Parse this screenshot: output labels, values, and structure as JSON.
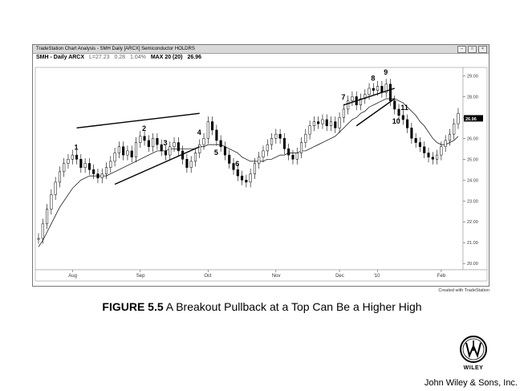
{
  "window": {
    "title": "TradeStation Chart Analysis - SMH Daily [ARCX] Semiconductor HOLDRS",
    "symbol": "SMH - Daily ARCX",
    "last": "L=27.23",
    "change": "0.28",
    "change_pct": "1.04%",
    "ma_label": "MAX 20 (20)",
    "ma_value": "26.96",
    "price_tag": "26.96",
    "credit": "Created with TradeStation"
  },
  "caption": {
    "figure": "FIGURE 5.5",
    "text": "A Breakout Pullback at a Top Can Be a Higher High"
  },
  "publisher": {
    "logo_word": "WILEY",
    "name": "John Wiley & Sons, Inc."
  },
  "colors": {
    "price": "#000000",
    "ma": "#000000",
    "tag_bg": "#000000"
  },
  "chart_data": {
    "type": "line",
    "title": "",
    "xlabel": "",
    "ylabel": "",
    "ylim": [
      19.7,
      29.4
    ],
    "yticks": [
      "29.00",
      "28.00",
      "27.00",
      "26.00",
      "25.00",
      "24.00",
      "23.00",
      "22.00",
      "21.00",
      "20.00"
    ],
    "x_tick_labels": [
      "Aug",
      "Sep",
      "Oct",
      "Nov",
      "Dec",
      "'10",
      "Feb"
    ],
    "x_ticks_at_bar": [
      8,
      24,
      40,
      56,
      71,
      80,
      95
    ],
    "grid": false,
    "series": [
      {
        "kind": "price",
        "values": [
          21.2,
          21.9,
          22.6,
          23.3,
          23.9,
          24.4,
          24.8,
          25.0,
          25.2,
          25.0,
          24.6,
          24.8,
          24.5,
          24.3,
          24.1,
          24.3,
          24.6,
          24.9,
          25.3,
          25.6,
          25.2,
          25.4,
          25.1,
          25.8,
          26.1,
          25.9,
          25.6,
          26.0,
          25.7,
          25.4,
          25.2,
          25.6,
          25.8,
          25.4,
          25.0,
          24.6,
          24.9,
          25.3,
          25.7,
          26.0,
          26.8,
          26.4,
          25.9,
          25.6,
          25.2,
          24.8,
          24.5,
          24.2,
          24.0,
          23.9,
          24.3,
          24.8,
          25.1,
          25.4,
          25.7,
          26.0,
          26.2,
          26.0,
          25.5,
          25.2,
          25.0,
          25.3,
          25.8,
          26.2,
          26.6,
          26.8,
          26.7,
          26.9,
          26.6,
          26.8,
          26.5,
          27.0,
          27.4,
          27.8,
          28.0,
          27.6,
          27.9,
          28.1,
          28.4,
          28.3,
          28.5,
          28.2,
          28.6,
          27.8,
          27.4,
          27.1,
          26.9,
          26.5,
          26.0,
          25.8,
          25.6,
          25.3,
          25.1,
          25.0,
          25.2,
          25.6,
          25.9,
          26.2,
          26.7,
          27.2
        ]
      },
      {
        "kind": "moving_average",
        "values": [
          20.8,
          21.1,
          21.5,
          21.9,
          22.3,
          22.7,
          23.0,
          23.3,
          23.6,
          23.8,
          24.0,
          24.1,
          24.2,
          24.2,
          24.2,
          24.2,
          24.2,
          24.3,
          24.4,
          24.5,
          24.6,
          24.7,
          24.8,
          24.9,
          25.0,
          25.1,
          25.2,
          25.3,
          25.4,
          25.4,
          25.4,
          25.5,
          25.5,
          25.5,
          25.5,
          25.5,
          25.5,
          25.5,
          25.6,
          25.6,
          25.7,
          25.7,
          25.7,
          25.7,
          25.6,
          25.5,
          25.4,
          25.3,
          25.1,
          25.0,
          24.9,
          24.9,
          24.9,
          24.9,
          25.0,
          25.0,
          25.1,
          25.2,
          25.2,
          25.3,
          25.3,
          25.3,
          25.4,
          25.4,
          25.5,
          25.6,
          25.7,
          25.8,
          25.9,
          26.0,
          26.1,
          26.3,
          26.5,
          26.7,
          26.9,
          27.0,
          27.2,
          27.3,
          27.5,
          27.6,
          27.7,
          27.8,
          27.9,
          27.9,
          27.9,
          27.8,
          27.7,
          27.5,
          27.3,
          27.1,
          26.8,
          26.6,
          26.3,
          26.0,
          25.8,
          25.7,
          25.7,
          25.8,
          25.9,
          26.1
        ]
      }
    ],
    "annotations": [
      {
        "label": "1",
        "bar": 9
      },
      {
        "label": "2",
        "bar": 25
      },
      {
        "label": "3",
        "bar": 30
      },
      {
        "label": "4",
        "bar": 38
      },
      {
        "label": "5",
        "bar": 42
      },
      {
        "label": "6",
        "bar": 47
      },
      {
        "label": "7",
        "bar": 72
      },
      {
        "label": "8",
        "bar": 79
      },
      {
        "label": "9",
        "bar": 82
      },
      {
        "label": "10",
        "bar": 84
      },
      {
        "label": "11",
        "bar": 86
      }
    ],
    "trendlines": [
      {
        "from": [
          9,
          26.5
        ],
        "to": [
          38,
          27.2
        ]
      },
      {
        "from": [
          18,
          23.8
        ],
        "to": [
          38,
          25.6
        ]
      },
      {
        "from": [
          72,
          27.6
        ],
        "to": [
          84,
          28.4
        ]
      },
      {
        "from": [
          75,
          26.6
        ],
        "to": [
          84,
          27.9
        ]
      }
    ]
  }
}
